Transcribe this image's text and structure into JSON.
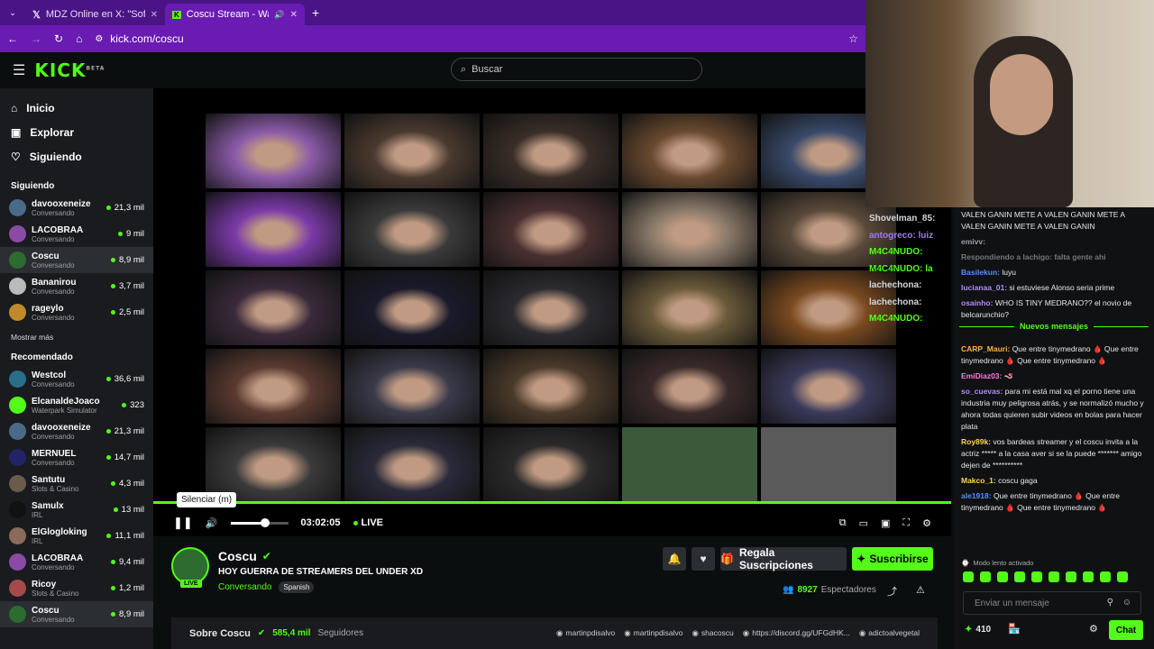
{
  "browser": {
    "tabs": [
      {
        "title": "MDZ Online en X: \"Sofía Maure",
        "icon": "x-logo-icon"
      },
      {
        "title": "Coscu Stream - Watch Live",
        "icon": "kick-icon"
      }
    ],
    "url": "kick.com/coscu"
  },
  "header": {
    "logo": "KICK",
    "beta": "BETA",
    "search_placeholder": "Buscar"
  },
  "nav": [
    {
      "label": "Inicio",
      "icon": "home-icon"
    },
    {
      "label": "Explorar",
      "icon": "compass-icon"
    },
    {
      "label": "Siguiendo",
      "icon": "heart-icon"
    }
  ],
  "following_title": "Siguiendo",
  "following": [
    {
      "name": "davooxeneize",
      "category": "Conversando",
      "viewers": "21,3 mil",
      "color": "#4b6a8a"
    },
    {
      "name": "LACOBRAA",
      "category": "Conversando",
      "viewers": "9 mil",
      "color": "#8a4ba8"
    },
    {
      "name": "Coscu",
      "category": "Conversando",
      "viewers": "8,9 mil",
      "color": "#2d6b31"
    },
    {
      "name": "Bananirou",
      "category": "Conversando",
      "viewers": "3,7 mil",
      "color": "#bbbbbb"
    },
    {
      "name": "rageylo",
      "category": "Conversando",
      "viewers": "2,5 mil",
      "color": "#c08a2c"
    }
  ],
  "show_more": "Mostrar más",
  "recommended_title": "Recomendado",
  "recommended": [
    {
      "name": "Westcol",
      "category": "Conversando",
      "viewers": "36,6 mil",
      "color": "#2a6e8c"
    },
    {
      "name": "ElcanaldeJoaco",
      "category": "Waterpark Simulator",
      "viewers": "323",
      "color": "#53fc18"
    },
    {
      "name": "davooxeneize",
      "category": "Conversando",
      "viewers": "21,3 mil",
      "color": "#4b6a8a"
    },
    {
      "name": "MERNUEL",
      "category": "Conversando",
      "viewers": "14,7 mil",
      "color": "#222266"
    },
    {
      "name": "Santutu",
      "category": "Slots & Casino",
      "viewers": "4,3 mil",
      "color": "#6c5a4a"
    },
    {
      "name": "Samulx",
      "category": "IRL",
      "viewers": "13 mil",
      "color": "#111111"
    },
    {
      "name": "ElGlogloking",
      "category": "IRL",
      "viewers": "11,1 mil",
      "color": "#8a6a5a"
    },
    {
      "name": "LACOBRAA",
      "category": "Conversando",
      "viewers": "9,4 mil",
      "color": "#8a4ba8"
    },
    {
      "name": "Ricoy",
      "category": "Slots & Casino",
      "viewers": "1,2 mil",
      "color": "#a44a4a"
    },
    {
      "name": "Coscu",
      "category": "Conversando",
      "viewers": "8,9 mil",
      "color": "#2d6b31"
    }
  ],
  "player": {
    "time": "03:02:05",
    "live": "LIVE",
    "tooltip": "Silenciar (m)",
    "volume": 0.6
  },
  "overlay_chat": [
    {
      "user": "Shovelman_85:",
      "color": "#cfd8dc"
    },
    {
      "user": "antogreco: luiz",
      "color": "#9c7cf4"
    },
    {
      "user": "M4C4NUDO:",
      "color": "#53fc18"
    },
    {
      "user": "M4C4NUDO: la",
      "color": "#53fc18"
    },
    {
      "user": "lachechona:",
      "color": "#cfd8dc"
    },
    {
      "user": "lachechona:",
      "color": "#cfd8dc"
    },
    {
      "user": "M4C4NUDO:",
      "color": "#53fc18"
    }
  ],
  "streamer": {
    "name": "Coscu",
    "title": "HOY GUERRA DE STREAMERS DEL UNDER XD",
    "category": "Conversando",
    "language": "Spanish",
    "live_badge": "LIVE",
    "gift_label": "Regala Suscripciones",
    "subscribe_label": "Suscribirse",
    "viewers": "8927",
    "viewers_label": "Espectadores",
    "about": "Sobre Coscu",
    "followers": "585,4 mil",
    "followers_label": "Seguidores",
    "socials": [
      {
        "handle": "martinpdisalvo",
        "icon": "x-logo-icon"
      },
      {
        "handle": "martinpdisalvo",
        "icon": "instagram-icon"
      },
      {
        "handle": "shacoscu",
        "icon": "youtube-icon"
      },
      {
        "handle": "https://discord.gg/UFGdHK...",
        "icon": "discord-icon"
      },
      {
        "handle": "adictoalvegetal",
        "icon": "tiktok-icon"
      }
    ]
  },
  "chat": {
    "top": "VALEN GANIN METE A VALEN GANIN METE A VALEN GANIN METE A VALEN GANIN",
    "pre": [
      {
        "user": "emivv:",
        "text": "",
        "color": "#9aa0a6"
      },
      {
        "user": "Respondiendo a lachigo: falta gente ahi",
        "text": "",
        "color": "#777777"
      },
      {
        "user": "Basilekun:",
        "text": "luyu",
        "color": "#5b8cff"
      },
      {
        "user": "lucianaa_01:",
        "text": "si estuviese Alonso seria prime",
        "color": "#b48cff"
      },
      {
        "user": "osainho:",
        "text": "WHO IS TINY MEDRANO?? el novio de belcarunchio?",
        "color": "#b48cff"
      }
    ],
    "new_label": "Nuevos mensajes",
    "messages": [
      {
        "user": "CARP_Mauri:",
        "text": "Que entre tinymedrano 🩸 Que entre tinymedrano 🩸 Que entre tinymedrano 🩸",
        "color": "#ffb347"
      },
      {
        "user": "EmiDiaz03:",
        "text": "🪱",
        "color": "#ff7ae0"
      },
      {
        "user": "so_cuevas:",
        "text": "para mi está mal xq el porno tiene una industria muy peligrosa atrás, y se normalizó mucho y ahora todas quieren subir videos en bolas para hacer plata",
        "color": "#b48cff"
      },
      {
        "user": "Roy89k:",
        "text": "vos bardeas streamer y el coscu invita a la actriz ***** a la casa aver si se la puede ******* amigo dejen de **********",
        "color": "#ffd54f"
      },
      {
        "user": "Makco_1:",
        "text": "coscu gaga",
        "color": "#ffd54f"
      },
      {
        "user": "ale1918:",
        "text": "Que entre tinymedrano 🩸 Que entre tinymedrano 🩸 Que entre tinymedrano 🩸",
        "color": "#5b8cff"
      }
    ],
    "slow_mode": "Modo lento activado",
    "input_placeholder": "Enviar un mensaje",
    "points": "410",
    "send_label": "Chat"
  }
}
